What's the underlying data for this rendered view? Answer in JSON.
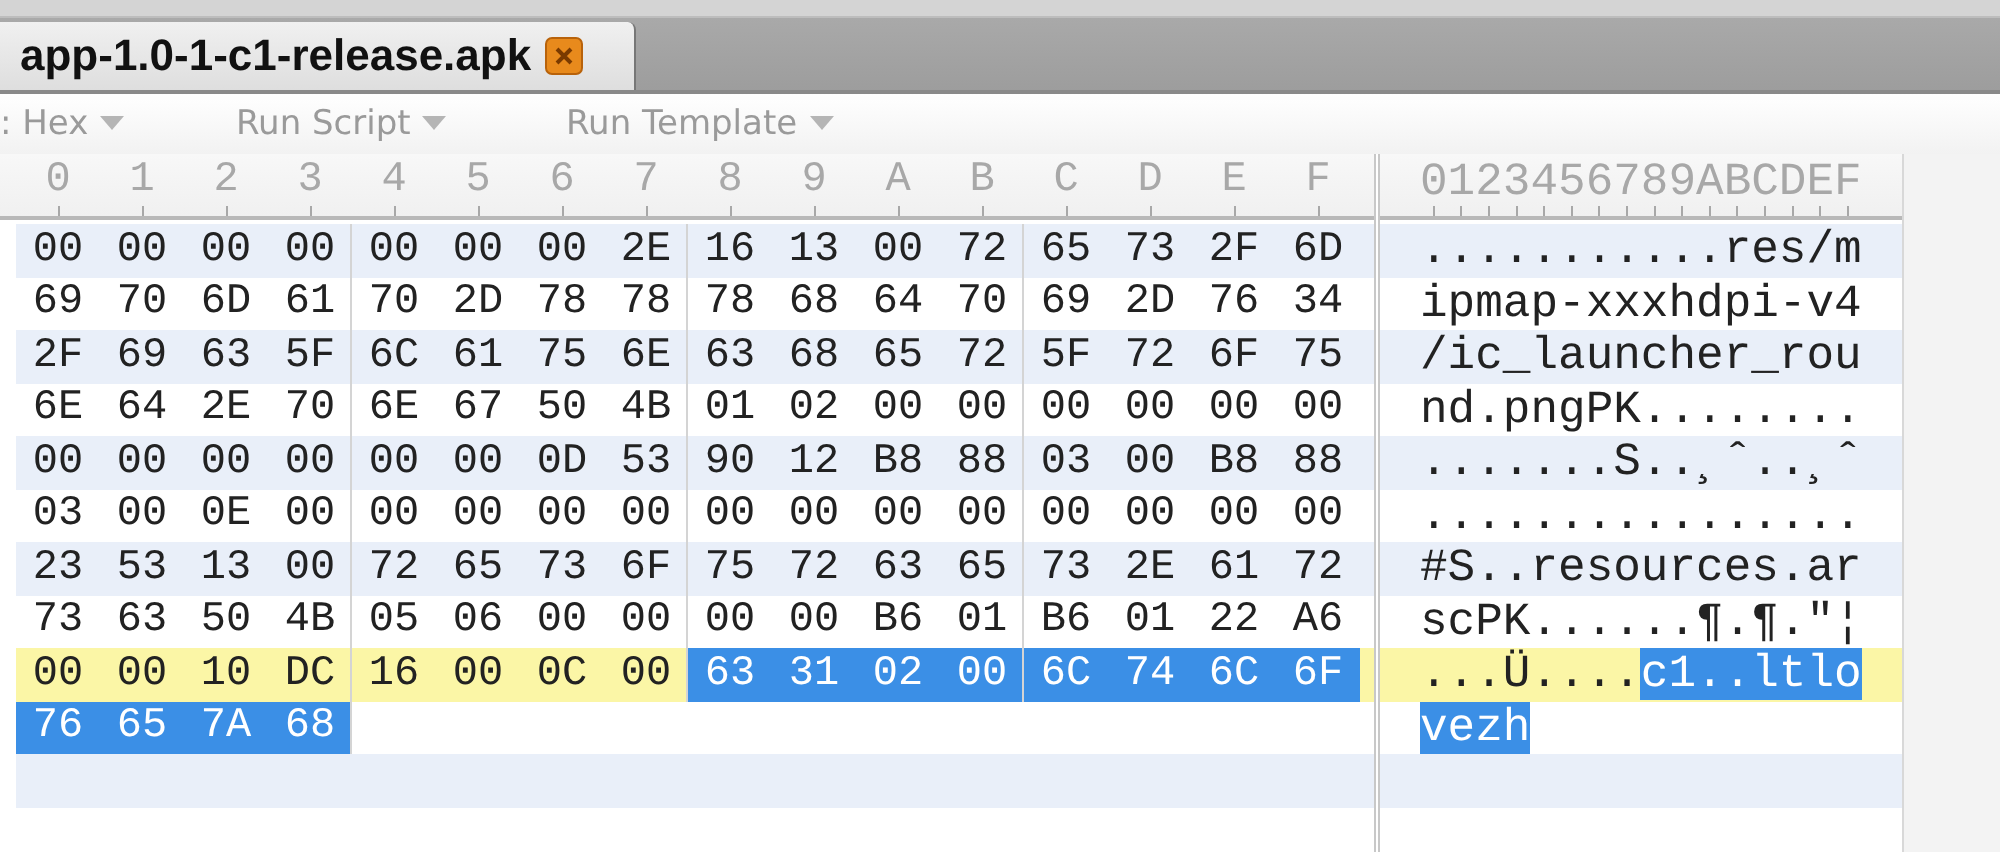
{
  "tab": {
    "title": "app-1.0-1-c1-release.apk",
    "selected": true
  },
  "toolbar": [
    {
      "label": ": Hex"
    },
    {
      "label": "Run Script"
    },
    {
      "label": "Run Template"
    }
  ],
  "hex_columns": [
    "0",
    "1",
    "2",
    "3",
    "4",
    "5",
    "6",
    "7",
    "8",
    "9",
    "A",
    "B",
    "C",
    "D",
    "E",
    "F"
  ],
  "text_header": "0123456789ABCDEF",
  "rows": [
    {
      "bytes": [
        "00",
        "00",
        "00",
        "00",
        "00",
        "00",
        "00",
        "2E",
        "16",
        "13",
        "00",
        "72",
        "65",
        "73",
        "2F",
        "6D"
      ],
      "text": "...........res/m",
      "current": false
    },
    {
      "bytes": [
        "69",
        "70",
        "6D",
        "61",
        "70",
        "2D",
        "78",
        "78",
        "78",
        "68",
        "64",
        "70",
        "69",
        "2D",
        "76",
        "34"
      ],
      "text": "ipmap-xxxhdpi-v4",
      "current": false
    },
    {
      "bytes": [
        "2F",
        "69",
        "63",
        "5F",
        "6C",
        "61",
        "75",
        "6E",
        "63",
        "68",
        "65",
        "72",
        "5F",
        "72",
        "6F",
        "75"
      ],
      "text": "/ic_launcher_rou",
      "current": false
    },
    {
      "bytes": [
        "6E",
        "64",
        "2E",
        "70",
        "6E",
        "67",
        "50",
        "4B",
        "01",
        "02",
        "00",
        "00",
        "00",
        "00",
        "00",
        "00"
      ],
      "text": "nd.pngPK........",
      "current": false
    },
    {
      "bytes": [
        "00",
        "00",
        "00",
        "00",
        "00",
        "00",
        "0D",
        "53",
        "90",
        "12",
        "B8",
        "88",
        "03",
        "00",
        "B8",
        "88"
      ],
      "text": ".......S..¸ˆ..¸ˆ",
      "current": false
    },
    {
      "bytes": [
        "03",
        "00",
        "0E",
        "00",
        "00",
        "00",
        "00",
        "00",
        "00",
        "00",
        "00",
        "00",
        "00",
        "00",
        "00",
        "00"
      ],
      "text": "................",
      "current": false
    },
    {
      "bytes": [
        "23",
        "53",
        "13",
        "00",
        "72",
        "65",
        "73",
        "6F",
        "75",
        "72",
        "63",
        "65",
        "73",
        "2E",
        "61",
        "72"
      ],
      "text": "#S..resources.ar",
      "current": false
    },
    {
      "bytes": [
        "73",
        "63",
        "50",
        "4B",
        "05",
        "06",
        "00",
        "00",
        "00",
        "00",
        "B6",
        "01",
        "B6",
        "01",
        "22",
        "A6"
      ],
      "text": "scPK......¶.¶.\"¦",
      "current": false
    },
    {
      "bytes": [
        "00",
        "00",
        "10",
        "DC",
        "16",
        "00",
        "0C",
        "00"
      ],
      "text": "...Ü....",
      "selected_bytes": [
        "63",
        "31",
        "02",
        "00",
        "6C",
        "74",
        "6C",
        "6F"
      ],
      "selected_text": "c1..ltlo",
      "current": true
    },
    {
      "selected_bytes": [
        "76",
        "65",
        "7A",
        "68"
      ],
      "selected_text": "vezh",
      "current": false
    }
  ]
}
